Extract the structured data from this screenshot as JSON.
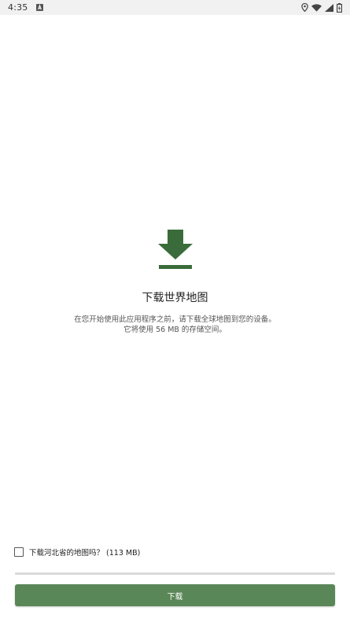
{
  "status_bar": {
    "time": "4:35"
  },
  "main": {
    "title": "下载世界地图",
    "description_line1": "在您开始使用此应用程序之前，请下载全球地图到您的设备。",
    "description_line2": "它将使用 56 MB 的存储空间。"
  },
  "option": {
    "checkbox_label": "下载河北省的地图吗？ (113 MB)",
    "checked": false
  },
  "actions": {
    "download_label": "下载"
  },
  "colors": {
    "accent": "#5a8757",
    "icon": "#3a6b3a",
    "status_bar_bg": "#f1f1f1"
  }
}
